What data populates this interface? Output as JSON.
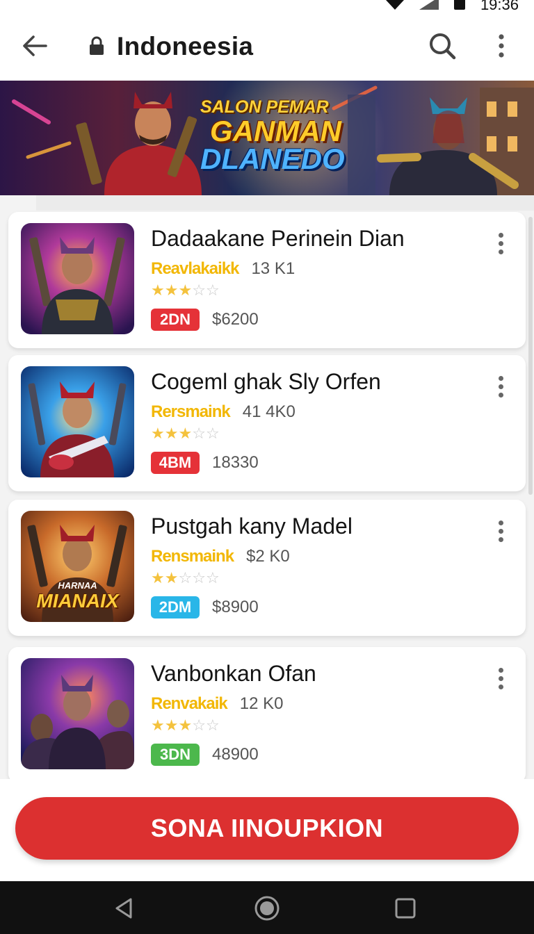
{
  "status_bar": {
    "time": "19:36"
  },
  "app_bar": {
    "title": "Indoneesia",
    "icons": [
      "back-arrow-icon",
      "lock-icon",
      "search-icon",
      "overflow-menu-icon"
    ]
  },
  "banner": {
    "line1": "SALON PEMAR",
    "line2": "GANMAN",
    "line3": "DLANEDO"
  },
  "games": [
    {
      "title": "Dadaakane Perinein Dian",
      "developer": "Reavlakaikk",
      "count": "13 K1",
      "rating": 3,
      "badge": "2DN",
      "badge_color": "#e53238",
      "price": "$6200",
      "thumb_label": ""
    },
    {
      "title": "Cogeml ghak Sly Orfen",
      "developer": "Rersmaink",
      "count": "41 4K0",
      "rating": 3,
      "badge": "4BM",
      "badge_color": "#e53238",
      "price": "18330",
      "thumb_label": ""
    },
    {
      "title": "Pustgah kany Madel",
      "developer": "Rensmaink",
      "count": "$2 K0",
      "rating": 2,
      "badge": "2DM",
      "badge_color": "#29b6e8",
      "price": "$8900",
      "thumb_label_top": "HARNAA",
      "thumb_label": "MIANAIX"
    },
    {
      "title": "Vanbonkan Ofan",
      "developer": "Renvakaik",
      "count": "12 K0",
      "rating": 3,
      "badge": "3DN",
      "badge_color": "#4cb84c",
      "price": "48900",
      "thumb_label": ""
    }
  ],
  "cta": {
    "label": "SONA IINOUPKION"
  },
  "nav": {
    "icons": [
      "back-triangle-icon",
      "home-circle-icon",
      "recents-square-icon"
    ]
  },
  "colors": {
    "accent": "#dc3030",
    "developer_gold": "#f2b705",
    "star": "#f4c23d"
  }
}
